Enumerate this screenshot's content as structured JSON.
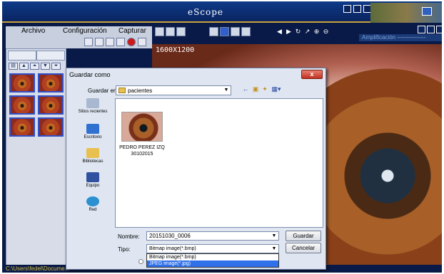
{
  "app": {
    "title": "eScope"
  },
  "menu": {
    "items": [
      "Archivo",
      "Configuración",
      "Capturar"
    ]
  },
  "toolbar": {
    "amplification_label": "Amplificación",
    "amplification_value": "---------------"
  },
  "image": {
    "resolution": "1600X1200"
  },
  "statusbar": {
    "text": "C:\\Users\\fedel\\Docume..."
  },
  "dialog": {
    "title": "Guardar como",
    "close_label": "x",
    "save_in_label": "Guardar en:",
    "save_in_value": "pacientes",
    "places": [
      {
        "label": "Sitios recientes",
        "icon": "recent-places-icon"
      },
      {
        "label": "Escritorio",
        "icon": "desktop-icon"
      },
      {
        "label": "Bibliotecas",
        "icon": "libraries-icon"
      },
      {
        "label": "Equipo",
        "icon": "computer-icon"
      },
      {
        "label": "Red",
        "icon": "network-icon"
      }
    ],
    "file": {
      "name_line1": "PEDRO PEREZ IZQ",
      "name_line2": "30102015"
    },
    "name_label": "Nombre:",
    "name_value": "20151030_0006",
    "type_label": "Tipo:",
    "type_value": "Bitmap image(*.bmp)",
    "type_options": [
      "Bitmap image(*.bmp)",
      "JPEG image(*.jpg)"
    ],
    "save_button": "Guardar",
    "cancel_button": "Cancelar"
  }
}
